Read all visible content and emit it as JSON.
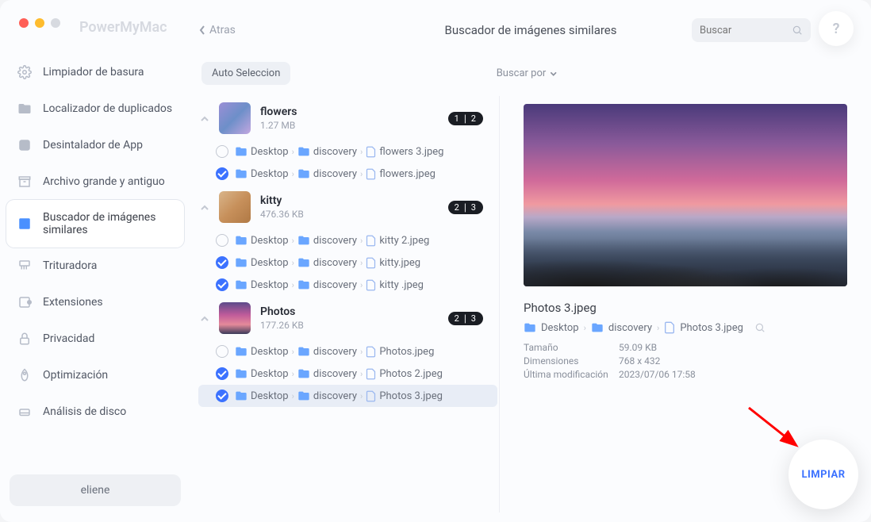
{
  "app_name": "PowerMyMac",
  "header": {
    "back_label": "Atras",
    "title": "Buscador de imágenes similares",
    "search_placeholder": "Buscar"
  },
  "sidebar": {
    "items": [
      {
        "label": "Limpiador de basura"
      },
      {
        "label": "Localizador de duplicados"
      },
      {
        "label": "Desintalador de App"
      },
      {
        "label": "Archivo grande y antiguo"
      },
      {
        "label": "Buscador de imágenes similares"
      },
      {
        "label": "Trituradora"
      },
      {
        "label": "Extensiones"
      },
      {
        "label": "Privacidad"
      },
      {
        "label": "Optimización"
      },
      {
        "label": "Análisis de disco"
      }
    ],
    "user": "eliene"
  },
  "toolbar": {
    "auto_label": "Auto Seleccion",
    "sort_label": "Buscar por"
  },
  "groups": [
    {
      "name": "flowers",
      "size": "1.27 MB",
      "badge": "1 ∣ 2",
      "files": [
        {
          "checked": false,
          "crumbs": [
            "Desktop",
            "discovery"
          ],
          "file": "flowers 3.jpeg"
        },
        {
          "checked": true,
          "crumbs": [
            "Desktop",
            "discovery"
          ],
          "file": "flowers.jpeg"
        }
      ]
    },
    {
      "name": "kitty",
      "size": "476.36 KB",
      "badge": "2 ∣ 3",
      "files": [
        {
          "checked": false,
          "crumbs": [
            "Desktop",
            "discovery"
          ],
          "file": "kitty 2.jpeg"
        },
        {
          "checked": true,
          "crumbs": [
            "Desktop",
            "discovery"
          ],
          "file": "kitty.jpeg"
        },
        {
          "checked": true,
          "crumbs": [
            "Desktop",
            "discovery"
          ],
          "file": "kitty .jpeg"
        }
      ]
    },
    {
      "name": "Photos",
      "size": "177.26 KB",
      "badge": "2 ∣ 3",
      "files": [
        {
          "checked": false,
          "crumbs": [
            "Desktop",
            "discovery"
          ],
          "file": "Photos.jpeg"
        },
        {
          "checked": true,
          "crumbs": [
            "Desktop",
            "discovery"
          ],
          "file": "Photos 2.jpeg"
        },
        {
          "checked": true,
          "crumbs": [
            "Desktop",
            "discovery"
          ],
          "file": "Photos 3.jpeg",
          "selected": true
        }
      ]
    }
  ],
  "preview": {
    "name": "Photos 3.jpeg",
    "path_crumbs": [
      "Desktop",
      "discovery"
    ],
    "path_file": "Photos 3.jpeg",
    "meta": {
      "size_label": "Tamaño",
      "size_value": "59.09 KB",
      "dim_label": "Dimensiones",
      "dim_value": "768 x 432",
      "mod_label": "Última modificación",
      "mod_value": "2023/07/06 17:58"
    }
  },
  "clean_label": "LIMPIAR"
}
